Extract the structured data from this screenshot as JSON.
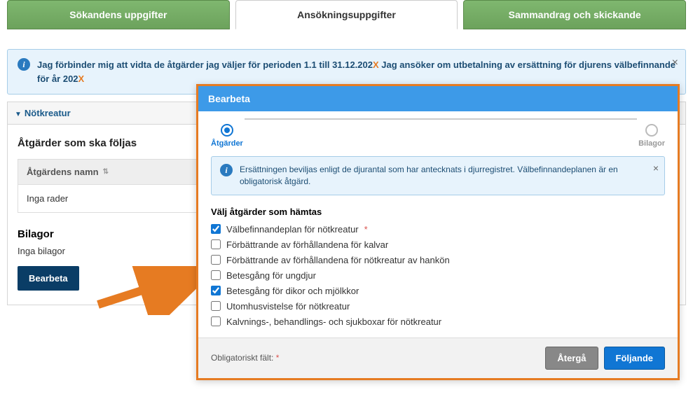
{
  "tabs": {
    "applicant": "Sökandens uppgifter",
    "application": "Ansökningsuppgifter",
    "summary": "Sammandrag och skickande"
  },
  "info_bar": {
    "text_part1": "Jag förbinder mig att vidta de åtgärder jag väljer för perioden 1.1 till 31.12.202",
    "text_part2": " Jag ansöker om utbetalning av ersättning för djurens välbefinnande för år 202",
    "placeholder": "X"
  },
  "collapse": {
    "title": "Nötkreatur"
  },
  "actions": {
    "heading": "Åtgärder som ska följas",
    "col_header": "Åtgärdens namn",
    "no_rows": "Inga rader"
  },
  "attachments": {
    "heading": "Bilagor",
    "no_attachments": "Inga bilagor",
    "edit_button": "Bearbeta"
  },
  "modal": {
    "title": "Bearbeta",
    "step1": "Åtgärder",
    "step2": "Bilagor",
    "info": "Ersättningen beviljas enligt de djurantal som har antecknats i djurregistret. Välbefinnandeplanen är en obligatorisk åtgärd.",
    "fetch_heading": "Välj åtgärder som hämtas",
    "options": [
      {
        "label": "Välbefinnandeplan för nötkreatur",
        "required": true,
        "checked": true
      },
      {
        "label": "Förbättrande av förhållandena för kalvar",
        "required": false,
        "checked": false
      },
      {
        "label": "Förbättrande av förhållandena för nötkreatur av hankön",
        "required": false,
        "checked": false
      },
      {
        "label": "Betesgång för ungdjur",
        "required": false,
        "checked": false
      },
      {
        "label": "Betesgång för dikor och mjölkkor",
        "required": false,
        "checked": true
      },
      {
        "label": "Utomhusvistelse för nötkreatur",
        "required": false,
        "checked": false
      },
      {
        "label": "Kalvnings-, behandlings- och sjukboxar för nötkreatur",
        "required": false,
        "checked": false
      }
    ],
    "required_label": "Obligatoriskt fält:",
    "back_button": "Återgå",
    "next_button": "Följande"
  }
}
